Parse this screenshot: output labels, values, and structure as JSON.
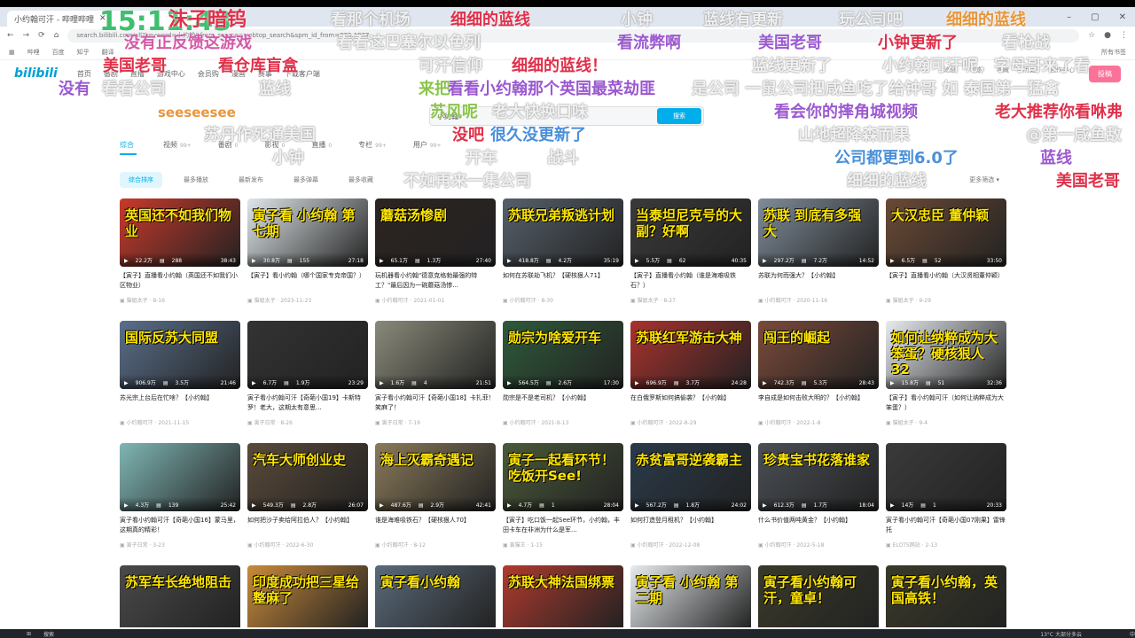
{
  "browser": {
    "tab_title": "小约翰可汗 - 哔哩哔哩",
    "url": "search.bilibili.com/all?keyword=小约翰&from_source=webtop_search&spm_id_from=333.1007",
    "bookmarks": [
      "哔哩",
      "百度",
      "知乎",
      "翻译"
    ],
    "bookmarks_right": "所有书签",
    "win_controls": [
      "–",
      "▢",
      "✕"
    ]
  },
  "site": {
    "logo": "bilibili",
    "nav": [
      "首页",
      "番剧",
      "直播",
      "游戏中心",
      "会员购",
      "漫画",
      "赛事",
      "下载客户端"
    ],
    "nav_right": [
      "消息",
      "动态",
      "收藏",
      "历史",
      "创作中心"
    ],
    "upload": "投稿"
  },
  "search": {
    "value": "小约翰",
    "button": "搜索"
  },
  "tabs": [
    {
      "label": "综合",
      "count": ""
    },
    {
      "label": "视频",
      "count": "99+"
    },
    {
      "label": "番剧",
      "count": "0"
    },
    {
      "label": "影视",
      "count": "0"
    },
    {
      "label": "直播",
      "count": "0"
    },
    {
      "label": "专栏",
      "count": "99+"
    },
    {
      "label": "用户",
      "count": "99+"
    }
  ],
  "filters": [
    "综合排序",
    "最多播放",
    "最新发布",
    "最多弹幕",
    "最多收藏"
  ],
  "more_filters": "更多筛选 ▾",
  "videos": [
    {
      "thumb": "英国还不如我们物业",
      "color": "#c8392b",
      "views": "22.2万",
      "dm": "288",
      "dur": "38:43",
      "title": "【寅子】直播看小约翰（英国还不如我们小区物业）",
      "author": "猫姐太子",
      "date": "8-16"
    },
    {
      "thumb": "寅子看 小约翰 第七期",
      "color": "#dfe6e9",
      "views": "30.8万",
      "dm": "155",
      "dur": "27:18",
      "title": "【寅子】看小约翰（哪个国家专克帝国？）",
      "author": "猫姐太子",
      "date": "2023-11-23"
    },
    {
      "thumb": "蘑菇汤惨剧",
      "color": "#2d2420",
      "views": "65.1万",
      "dm": "1.3万",
      "dur": "27:40",
      "title": "玩机器看小约翰\"德意克格勃最强的特工？\"最后因为一碗蘑菇汤惨...",
      "author": "小约翰可汗",
      "date": "2021-01-01"
    },
    {
      "thumb": "苏联兄弟叛逃计划",
      "color": "#56606b",
      "views": "418.8万",
      "dm": "4.2万",
      "dur": "35:19",
      "title": "如何在苏联劫飞机？【硬核狠人71】",
      "author": "小约翰可汗",
      "date": "8-30"
    },
    {
      "thumb": "当泰坦尼克号的大副？好啊",
      "color": "#3a3a3a",
      "views": "5.5万",
      "dm": "62",
      "dur": "40:35",
      "title": "【寅子】直播看小约翰（谁是海难吸铁石？）",
      "author": "猫姐太子",
      "date": "8-27"
    },
    {
      "thumb": "苏联 到底有多强大",
      "color": "#7f8c99",
      "views": "297.2万",
      "dm": "7.2万",
      "dur": "14:52",
      "title": "苏联为何而强大？【小约翰】",
      "author": "小约翰可汗",
      "date": "2020-11-16"
    },
    {
      "thumb": "大汉忠臣 董仲颖",
      "color": "#6b4a36",
      "views": "6.5万",
      "dm": "52",
      "dur": "33:50",
      "title": "【寅子】直播看小约翰（大汉贤相董仲颖）",
      "author": "猫姐太子",
      "date": "9-29"
    },
    {
      "thumb": "国际反苏大同盟",
      "color": "#5a6f8a",
      "views": "906.9万",
      "dm": "3.5万",
      "dur": "21:46",
      "title": "苏光宗上台后在忙啥？【小约翰】",
      "author": "小约翰可汗",
      "date": "2021-11-15"
    },
    {
      "thumb": "",
      "color": "#333333",
      "views": "6.7万",
      "dm": "1.9万",
      "dur": "23:29",
      "title": "寅子看小约翰可汗【奇葩小国19】卡斯特罗！老大，这期太有意思...",
      "author": "寅子日常",
      "date": "8-26"
    },
    {
      "thumb": "",
      "color": "#8a8a7a",
      "views": "1.6万",
      "dm": "4",
      "dur": "21:51",
      "title": "寅子看小约翰可汗【奇葩小国18】卡扎菲！笑麻了！",
      "author": "寅子日常",
      "date": "7-19"
    },
    {
      "thumb": "勋宗为啥爱开车",
      "color": "#2e5a3a",
      "views": "564.5万",
      "dm": "2.6万",
      "dur": "17:30",
      "title": "勋宗是不是老司机？【小约翰】",
      "author": "小约翰可汗",
      "date": "2021-9-13"
    },
    {
      "thumb": "苏联红军游击大神",
      "color": "#a8322d",
      "views": "696.9万",
      "dm": "3.7万",
      "dur": "24:28",
      "title": "在白俄罗斯如何搞偷袭？【小约翰】",
      "author": "小约翰可汗",
      "date": "2022-8-29"
    },
    {
      "thumb": "闯王的崛起",
      "color": "#7a4a3a",
      "views": "742.3万",
      "dm": "5.3万",
      "dur": "28:43",
      "title": "李自成是如何击败大明的？【小约翰】",
      "author": "小约翰可汗",
      "date": "2022-1-8"
    },
    {
      "thumb": "如何让纳粹成为大笨蛋？硬核狠人32",
      "color": "#e8ecef",
      "views": "15.8万",
      "dm": "51",
      "dur": "32:36",
      "title": "【寅子】看小约翰可汗（如何让纳粹成为大笨蛋？）",
      "author": "猫姐太子",
      "date": "9-4"
    },
    {
      "thumb": "",
      "color": "#7fb6b4",
      "views": "4.3万",
      "dm": "139",
      "dur": "25:42",
      "title": "寅子看小约翰可汗【奇葩小国16】蒙马里，这期真的精彩！",
      "author": "寅子日常",
      "date": "3-23"
    },
    {
      "thumb": "汽车大师创业史",
      "color": "#5a4a3a",
      "views": "549.3万",
      "dm": "2.8万",
      "dur": "26:07",
      "title": "如何把沙子卖给阿拉伯人？【小约翰】",
      "author": "小约翰可汗",
      "date": "2022-6-30"
    },
    {
      "thumb": "海上灭霸奇遇记",
      "color": "#8a7a5a",
      "views": "487.6万",
      "dm": "2.9万",
      "dur": "42:41",
      "title": "谁是海难吸铁石？【硬核狠人70】",
      "author": "小约翰可汗",
      "date": "8-12"
    },
    {
      "thumb": "寅子一起看环节！吃饭开See!",
      "color": "#4a5a3a",
      "views": "4.7万",
      "dm": "1",
      "dur": "28:04",
      "title": "【寅子】吃口饭一起See环节，小约翰，丰田卡车在非洲为什么是军...",
      "author": "寅猫王",
      "date": "1-15"
    },
    {
      "thumb": "赤贫富哥逆袭霸主",
      "color": "#2a3a4a",
      "views": "567.2万",
      "dm": "1.8万",
      "dur": "24:02",
      "title": "如何打造登月租机？【小约翰】",
      "author": "小约翰可汗",
      "date": "2022-12-08"
    },
    {
      "thumb": "珍贵宝书花落谁家",
      "color": "#4a4f55",
      "views": "612.3万",
      "dm": "1.7万",
      "dur": "18:04",
      "title": "什么书价值两吨黄金？【小约翰】",
      "author": "小约翰可汗",
      "date": "2022-5-18"
    },
    {
      "thumb": "",
      "color": "#3a3a3a",
      "views": "14万",
      "dm": "1",
      "dur": "20:33",
      "title": "寅子看小约翰可汗【奇葩小国07刚果】雷锋托",
      "author": "ELOTS网站",
      "date": "2-13"
    },
    {
      "thumb": "苏军车长绝地阻击",
      "color": "#4a4a4a",
      "views": "",
      "dm": "",
      "dur": "",
      "title": "",
      "author": "",
      "date": ""
    },
    {
      "thumb": "印度成功把三星给整麻了",
      "color": "#c98a3a",
      "views": "",
      "dm": "",
      "dur": "",
      "title": "",
      "author": "",
      "date": ""
    },
    {
      "thumb": "寅子看小约翰",
      "color": "#5a6a7a",
      "views": "",
      "dm": "",
      "dur": "",
      "title": "",
      "author": "",
      "date": ""
    },
    {
      "thumb": "苏联大神法国绑票",
      "color": "#b03a2e",
      "views": "",
      "dm": "",
      "dur": "",
      "title": "",
      "author": "",
      "date": ""
    },
    {
      "thumb": "寅子看 小约翰 第二期",
      "color": "#e8ecef",
      "views": "",
      "dm": "",
      "dur": "",
      "title": "",
      "author": "",
      "date": ""
    },
    {
      "thumb": "寅子看小约翰可汗，童卓！",
      "color": "#3a3a2a",
      "views": "",
      "dm": "",
      "dur": "",
      "title": "",
      "author": "",
      "date": ""
    },
    {
      "thumb": "寅子看小约翰，英国高铁！",
      "color": "#3a3a2a",
      "views": "",
      "dm": "",
      "dur": "",
      "title": "",
      "author": "",
      "date": ""
    }
  ],
  "danmaku": [
    {
      "text": "15:11:43",
      "color": "#3fbf6f"
    },
    {
      "text": "沫子暗钨",
      "color": "#e0304a"
    },
    {
      "text": "看那个机场",
      "color": "white"
    },
    {
      "text": "细细的蓝线",
      "color": "#e0304a"
    },
    {
      "text": "小钟",
      "color": "white"
    },
    {
      "text": "蓝线有更新",
      "color": "white"
    },
    {
      "text": "玩公司吧",
      "color": "white"
    },
    {
      "text": "细细的蓝线",
      "color": "#e8963a"
    },
    {
      "text": "没有正反馈这游戏",
      "color": "#d45aa8"
    },
    {
      "text": "看看这巴塞尔以色列",
      "color": "white"
    },
    {
      "text": "看流弊啊",
      "color": "#9b59d0"
    },
    {
      "text": "美国老哥",
      "color": "#9b59d0"
    },
    {
      "text": "小钟更新了",
      "color": "#e0304a"
    },
    {
      "text": "看枪战",
      "color": "white"
    },
    {
      "text": "美国老哥",
      "color": "#e0304a"
    },
    {
      "text": "看仓库盲盒",
      "color": "#e0304a"
    },
    {
      "text": "可汗信仰",
      "color": "white"
    },
    {
      "text": "细细的蓝线！",
      "color": "#e0304a"
    },
    {
      "text": "蓝线更新了",
      "color": "white"
    },
    {
      "text": "小约翰可汗呢，字母哥来了看",
      "color": "white"
    },
    {
      "text": "没有",
      "color": "#9b59d0"
    },
    {
      "text": "看看公司",
      "color": "white"
    },
    {
      "text": "蓝线",
      "color": "white"
    },
    {
      "text": "来把",
      "color": "#8ac44a"
    },
    {
      "text": "看看小约翰那个英国最菜劫匪",
      "color": "#9b59d0"
    },
    {
      "text": "是公司 一鼠公司把咸鱼吃了给钟哥 如 泰国第一猛禽",
      "color": "white"
    },
    {
      "text": "seeseesee",
      "color": "#e8963a"
    },
    {
      "text": "苏风呢",
      "color": "#8ac44a"
    },
    {
      "text": "老大快换口味",
      "color": "white"
    },
    {
      "text": "看会你的摔角城视频",
      "color": "#9b59d0"
    },
    {
      "text": "老大推荐你看咻弗",
      "color": "#e0304a"
    },
    {
      "text": "苏丹作死通美国",
      "color": "white"
    },
    {
      "text": "没吧",
      "color": "#e0304a"
    },
    {
      "text": "很久没更新了",
      "color": "#4a90d9"
    },
    {
      "text": "山地超降森而果",
      "color": "white"
    },
    {
      "text": "@第一咸鱼敌",
      "color": "white"
    },
    {
      "text": "小钟",
      "color": "white"
    },
    {
      "text": "开车",
      "color": "white"
    },
    {
      "text": "战斗",
      "color": "white"
    },
    {
      "text": "公司都更到6.0了",
      "color": "#4a90d9"
    },
    {
      "text": "蓝线",
      "color": "#9b59d0"
    },
    {
      "text": "不如再来一集公司",
      "color": "white"
    },
    {
      "text": "细细的蓝线",
      "color": "white"
    },
    {
      "text": "美国老哥",
      "color": "#e0304a"
    }
  ],
  "taskbar": {
    "search": "搜索",
    "weather": "13°C 大部分多云",
    "ime": "中"
  }
}
